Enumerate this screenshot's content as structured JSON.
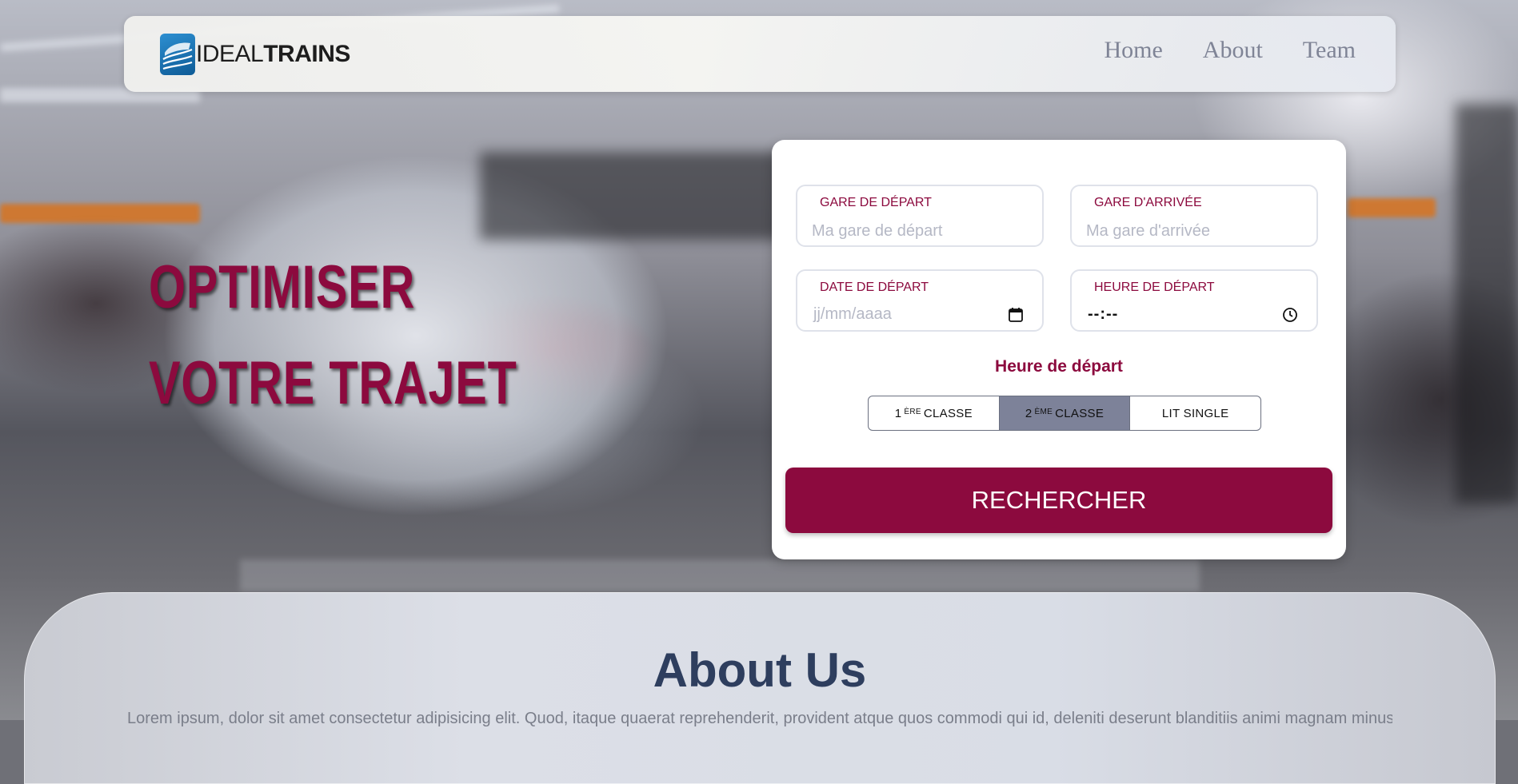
{
  "brand": {
    "name_light": "IDEAL",
    "name_bold": "TRAINS",
    "logo_icon": "train-logo-icon"
  },
  "nav": {
    "links": [
      "Home",
      "About",
      "Team"
    ]
  },
  "hero": {
    "line1": "OPTIMISER",
    "line2": "VOTRE TRAJET"
  },
  "search": {
    "departure": {
      "label": "GARE DE DÉPART",
      "placeholder": "Ma gare de départ"
    },
    "arrival": {
      "label": "GARE D'ARRIVÉE",
      "placeholder": "Ma gare d'arrivée"
    },
    "date": {
      "label": "DATE DE DÉPART",
      "value": "jj/mm/aaaa",
      "icon": "calendar-icon"
    },
    "time": {
      "label": "HEURE DE DÉPART",
      "value": "--:--",
      "icon": "clock-icon"
    },
    "section_label": "Heure de départ",
    "classes": {
      "first": {
        "num": "1",
        "sup": "ÈRE",
        "word": "CLASSE"
      },
      "second": {
        "num": "2",
        "sup": "ÈME",
        "word": "CLASSE"
      },
      "single": {
        "word": "LIT SINGLE"
      },
      "selected": "second"
    },
    "submit_label": "RECHERCHER"
  },
  "about": {
    "title": "About Us",
    "text": "Lorem ipsum, dolor sit amet consectetur adipisicing elit. Quod, itaque quaerat reprehenderit, provident atque quos commodi qui id, deleniti deserunt blanditiis animi magnam minus"
  },
  "colors": {
    "accent": "#8c0a3e",
    "nav_link": "#7f8496",
    "about_title": "#2e3e5e",
    "selected_class": "#7d8299"
  }
}
